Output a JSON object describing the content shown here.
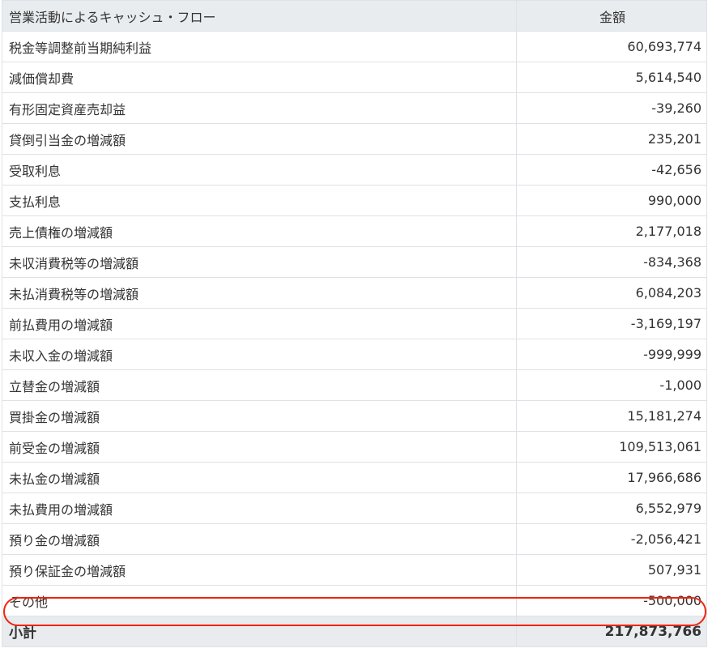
{
  "header": {
    "label": "営業活動によるキャッシュ・フロー",
    "amount": "金額"
  },
  "rows": [
    {
      "label": "税金等調整前当期純利益",
      "amount": "60,693,774"
    },
    {
      "label": "減価償却費",
      "amount": "5,614,540"
    },
    {
      "label": "有形固定資産売却益",
      "amount": "-39,260"
    },
    {
      "label": "貸倒引当金の増減額",
      "amount": "235,201"
    },
    {
      "label": "受取利息",
      "amount": "-42,656"
    },
    {
      "label": "支払利息",
      "amount": "990,000"
    },
    {
      "label": "売上債権の増減額",
      "amount": "2,177,018"
    },
    {
      "label": "未収消費税等の増減額",
      "amount": "-834,368"
    },
    {
      "label": "未払消費税等の増減額",
      "amount": "6,084,203"
    },
    {
      "label": "前払費用の増減額",
      "amount": "-3,169,197"
    },
    {
      "label": "未収入金の増減額",
      "amount": "-999,999"
    },
    {
      "label": "立替金の増減額",
      "amount": "-1,000"
    },
    {
      "label": "買掛金の増減額",
      "amount": "15,181,274"
    },
    {
      "label": "前受金の増減額",
      "amount": "109,513,061"
    },
    {
      "label": "未払金の増減額",
      "amount": "17,966,686"
    },
    {
      "label": "未払費用の増減額",
      "amount": "6,552,979"
    },
    {
      "label": "預り金の増減額",
      "amount": "-2,056,421"
    },
    {
      "label": "預り保証金の増減額",
      "amount": "507,931"
    },
    {
      "label": "その他",
      "amount": "-500,000"
    }
  ],
  "total": {
    "label": "小計",
    "amount": "217,873,766"
  },
  "highlight_color": "#f0230f"
}
